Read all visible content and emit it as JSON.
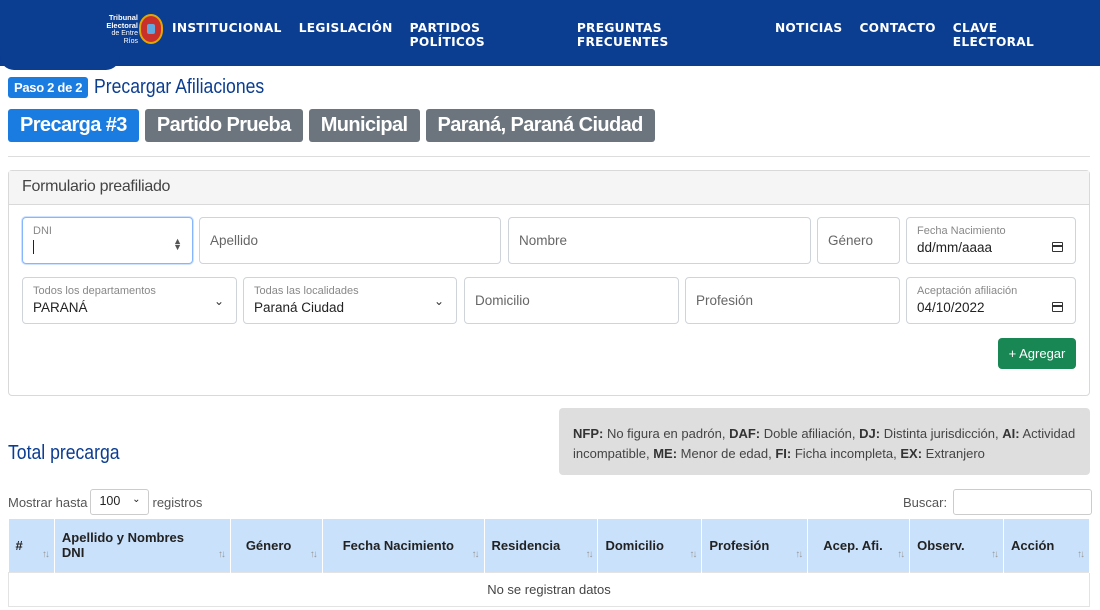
{
  "header": {
    "logo": {
      "line1": "Tribunal",
      "line2": "Electoral",
      "line3": "de Entre Ríos"
    },
    "nav": [
      "INSTITUCIONAL",
      "LEGISLACIÓN",
      "PARTIDOS POLÍTICOS",
      "PREGUNTAS FRECUENTES",
      "NOTICIAS",
      "CONTACTO",
      "CLAVE ELECTORAL"
    ]
  },
  "step": {
    "badge": "Paso 2 de 2",
    "title": "Precargar Afiliaciones"
  },
  "chips": [
    "Precarga #3",
    "Partido Prueba",
    "Municipal",
    "Paraná, Paraná Ciudad"
  ],
  "form": {
    "title": "Formulario preafiliado",
    "dni": {
      "label": "DNI",
      "value": ""
    },
    "apellido": {
      "placeholder": "Apellido"
    },
    "nombre": {
      "placeholder": "Nombre"
    },
    "genero": {
      "placeholder": "Género"
    },
    "fecha_nacimiento": {
      "label": "Fecha Nacimiento",
      "value": "dd/mm/aaaa"
    },
    "departamento": {
      "label": "Todos los departamentos",
      "value": "PARANÁ"
    },
    "localidad": {
      "label": "Todas las localidades",
      "value": "Paraná Ciudad"
    },
    "domicilio": {
      "placeholder": "Domicilio"
    },
    "profesion": {
      "placeholder": "Profesión"
    },
    "aceptacion": {
      "label": "Aceptación afiliación",
      "value": "04/10/2022"
    },
    "add_button": "+ Agregar"
  },
  "legend": [
    {
      "code": "NFP:",
      "text": " No figura en padrón, "
    },
    {
      "code": "DAF:",
      "text": " Doble afiliación, "
    },
    {
      "code": "DJ:",
      "text": " Distinta jurisdicción, "
    },
    {
      "code": "AI:",
      "text": " Actividad incompatible, "
    },
    {
      "code": "ME:",
      "text": " Menor de edad, "
    },
    {
      "code": "FI:",
      "text": " Ficha incompleta, "
    },
    {
      "code": "EX:",
      "text": " Extranjero"
    }
  ],
  "total": {
    "title": "Total precarga",
    "show_prefix": "Mostrar hasta",
    "show_value": "100",
    "show_suffix": "registros",
    "search_label": "Buscar:",
    "columns": [
      "#",
      "Apellido y Nombres DNI",
      "Género",
      "Fecha Nacimiento",
      "Residencia",
      "Domicilio",
      "Profesión",
      "Acep. Afi.",
      "Observ.",
      "Acción"
    ],
    "empty": "No se registran datos"
  },
  "colors": {
    "navy": "#0b3d91",
    "primary": "#1a7be0",
    "secondary": "#6c757d",
    "success": "#198754",
    "table_header": "#c9e1fb"
  }
}
